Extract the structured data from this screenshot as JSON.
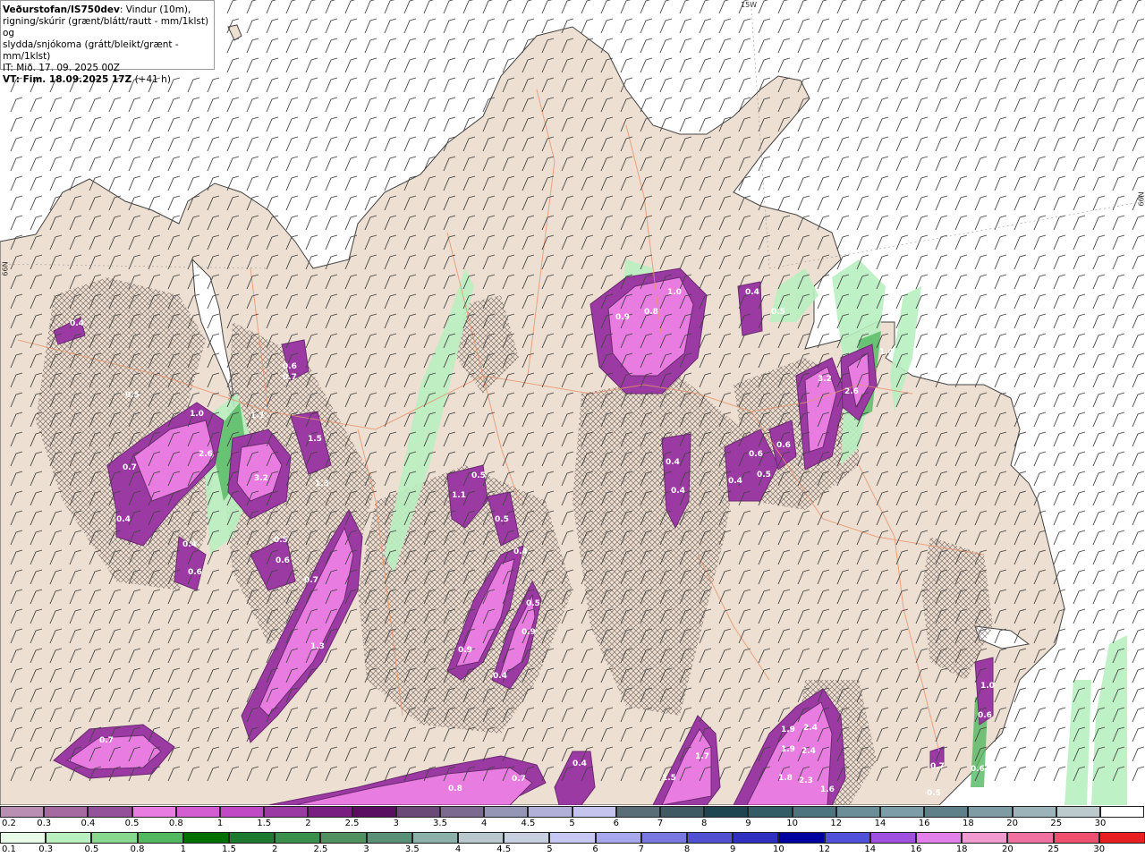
{
  "header": {
    "title": "Veðurstofan/IS750dev",
    "subtitle_1": ": Vindur (10m),",
    "subtitle_2": "rigning/skúrir (grænt/blátt/rautt - mm/1klst) og",
    "subtitle_3": "slydda/snjókoma (grátt/bleikt/grænt - mm/1klst)",
    "init_time": "IT: Mið. 17. 09. 2025 00Z",
    "valid_time": "VT: Fim. 18.09.2025 17Z",
    "lead": " (+41 h)"
  },
  "edge_labels": {
    "top": "15W",
    "right": "66N",
    "left": "66N"
  },
  "map_labels": [
    "0.4",
    "0.6",
    "0.5",
    "1.0",
    "1.1",
    "0.7",
    "2.6",
    "3.2",
    "1.5",
    "1.3",
    "0.4",
    "0.4",
    "0.6",
    "0.5",
    "0.6",
    "0.7",
    "1.3",
    "0.7",
    "1.1",
    "0.5",
    "0.5",
    "0.4",
    "0.9",
    "0.5",
    "0.9",
    "0.4",
    "0.9",
    "0.8",
    "1.0",
    "0.4",
    "0.5",
    "3.2",
    "2.6",
    "1.4",
    "0.4",
    "0.4",
    "0.6",
    "0.5",
    "0.6",
    "0.4",
    "1.9",
    "2.4",
    "1.9",
    "2.4",
    "1.8",
    "2.3",
    "1.7",
    "1.5",
    "1.6",
    "0.7",
    "0.8",
    "0.7",
    "0.4",
    "0.7",
    "0.5",
    "1.0",
    "0.6",
    "0.6"
  ],
  "colorbars": {
    "snow": {
      "labels": [
        "0.2",
        "0.3",
        "0.4",
        "0.5",
        "0.8",
        "1",
        "1.5",
        "2",
        "2.5",
        "3",
        "3.5",
        "4",
        "4.5",
        "5",
        "6",
        "7",
        "8",
        "9",
        "10",
        "12",
        "14",
        "16",
        "18",
        "20",
        "25",
        "30"
      ],
      "colors": [
        "#b98fb3",
        "#a56aa0",
        "#94529a",
        "#e87ce0",
        "#d25ed1",
        "#c04ac5",
        "#9b3aa3",
        "#7a1f82",
        "#5a0f60",
        "#6b4a78",
        "#7d6a90",
        "#9595b5",
        "#b0b0d8",
        "#c4c4ee",
        "#5a6e78",
        "#3f5a63",
        "#1f4650",
        "#345c66",
        "#4e7480",
        "#6b8e98",
        "#7d9ea8",
        "#5f8088",
        "#7f9ca4",
        "#9cb3b9",
        "#bcc9cd",
        "#ffffff"
      ]
    },
    "rain": {
      "labels": [
        "0.1",
        "0.3",
        "0.5",
        "0.8",
        "1",
        "1.5",
        "2",
        "2.5",
        "3",
        "3.5",
        "4",
        "4.5",
        "5",
        "6",
        "7",
        "8",
        "9",
        "10",
        "12",
        "14",
        "16",
        "18",
        "20",
        "25",
        "30"
      ],
      "colors": [
        "#e8fae8",
        "#b8f0c0",
        "#88d890",
        "#52b860",
        "#007000",
        "#1e7a30",
        "#3a8f4a",
        "#4f8f60",
        "#5a8f78",
        "#8ab0a8",
        "#b8c8cc",
        "#c8d0e0",
        "#c8c8f4",
        "#a8a8ee",
        "#7878e0",
        "#5050d0",
        "#3030c0",
        "#0000a0",
        "#5050d8",
        "#a050e0",
        "#e080e8",
        "#f09ad0",
        "#f070a0",
        "#f05070",
        "#e82020"
      ]
    }
  }
}
